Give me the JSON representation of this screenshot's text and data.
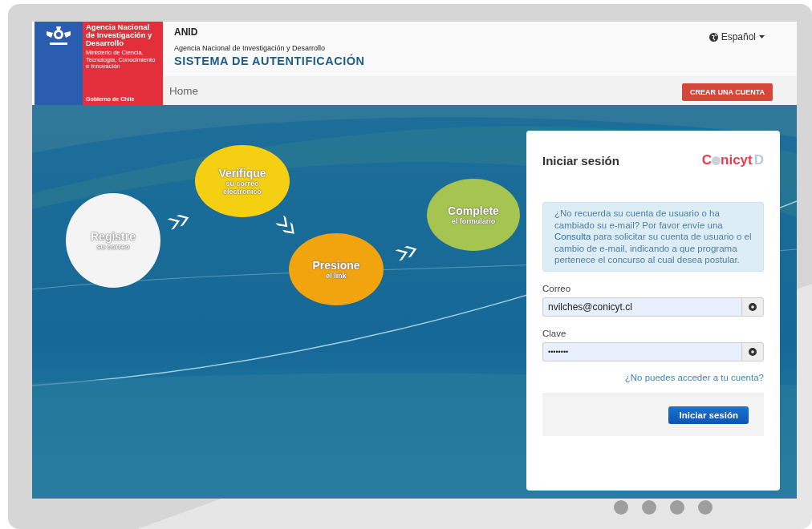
{
  "header": {
    "logo": {
      "agency": "Agencia Nacional de Investigación y Desarrollo",
      "ministry": "Ministerio de Ciencia, Tecnología, Conocimiento e Innovación",
      "government": "Gobierno de Chile"
    },
    "short_name": "ANID",
    "agency_name": "Agencia Nacional de Investigación y Desarrollo",
    "system_title": "SISTEMA DE AUTENTIFICACIÓN",
    "language": "Español"
  },
  "nav": {
    "items": [
      {
        "label": "Home"
      }
    ],
    "create_account": "CREAR UNA CUENTA"
  },
  "steps": [
    {
      "title": "Registre",
      "subtitle": "su correo",
      "color": "#f4f4f4"
    },
    {
      "title": "Verifique",
      "subtitle": "su correo electrónico",
      "color": "#f5cf12"
    },
    {
      "title": "Presione",
      "subtitle": "el link",
      "color": "#f2a40e"
    },
    {
      "title": "Complete",
      "subtitle": "el formulario",
      "color": "#a6c450"
    }
  ],
  "login": {
    "title": "Iniciar sesión",
    "brand": {
      "before": "C",
      "after": "nicyt",
      "mark": "D"
    },
    "info": {
      "before": "¿No recuerda su cuenta de usuario o ha cambiado su e-mail? Por favor envíe una",
      "link": "Consulta",
      "after": "para solicitar su cuenta de usuario o el cambio de e-mail, indicando a que programa pertenece el concurso al cual desea postular."
    },
    "fields": [
      {
        "label": "Correo",
        "value": "nvilches@conicyt.cl",
        "kind": "text"
      },
      {
        "label": "Clave",
        "value": "••••••••",
        "kind": "password"
      }
    ],
    "forgot_link": "¿No puedes acceder a tu cuenta?",
    "submit": "Iniciar sesión"
  },
  "carousel": {
    "dots": [
      {
        "selected": false
      },
      {
        "selected": false
      },
      {
        "selected": false
      },
      {
        "selected": false
      }
    ]
  }
}
